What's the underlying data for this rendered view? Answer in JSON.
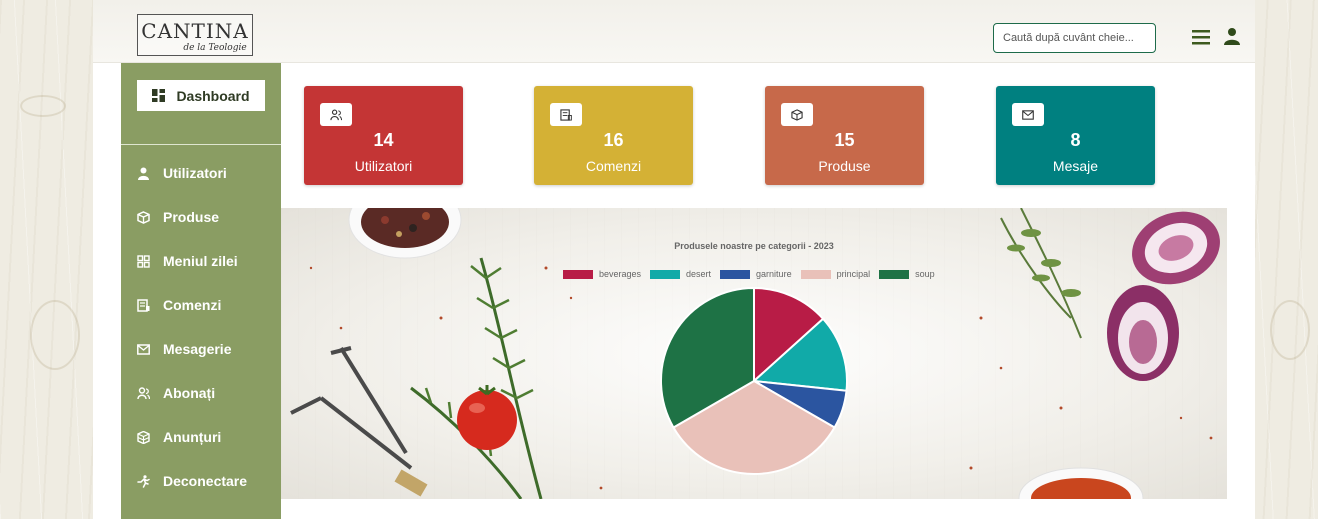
{
  "header": {
    "logo_main": "CANTINA",
    "logo_sub": "de la Teologie",
    "search_placeholder": "Caută după cuvânt cheie..."
  },
  "sidebar": {
    "dashboard_label": "Dashboard",
    "items": [
      {
        "label": "Utilizatori",
        "icon": "user-icon"
      },
      {
        "label": "Produse",
        "icon": "box-icon"
      },
      {
        "label": "Meniul zilei",
        "icon": "grid-icon"
      },
      {
        "label": "Comenzi",
        "icon": "receipt-icon"
      },
      {
        "label": "Mesagerie",
        "icon": "envelope-icon"
      },
      {
        "label": "Abonați",
        "icon": "users-icon"
      },
      {
        "label": "Anunțuri",
        "icon": "boxes-icon"
      },
      {
        "label": "Deconectare",
        "icon": "running-icon"
      }
    ]
  },
  "cards": [
    {
      "count": "14",
      "label": "Utilizatori",
      "color": "#c43535",
      "icon": "users-icon"
    },
    {
      "count": "16",
      "label": "Comenzi",
      "color": "#d4b135",
      "icon": "receipt-icon"
    },
    {
      "count": "15",
      "label": "Produse",
      "color": "#c7694a",
      "icon": "box-icon"
    },
    {
      "count": "8",
      "label": "Mesaje",
      "color": "#008080",
      "icon": "envelope-icon"
    }
  ],
  "chart_data": {
    "type": "pie",
    "title": "Produsele noastre pe categorii - 2023",
    "categories": [
      "beverages",
      "desert",
      "garniture",
      "principal",
      "soup"
    ],
    "values": [
      2,
      2,
      1,
      5,
      5
    ],
    "colors": [
      "#b81c46",
      "#11aaa8",
      "#2b55a0",
      "#e9c1b9",
      "#1e7245"
    ],
    "legend": "top"
  }
}
